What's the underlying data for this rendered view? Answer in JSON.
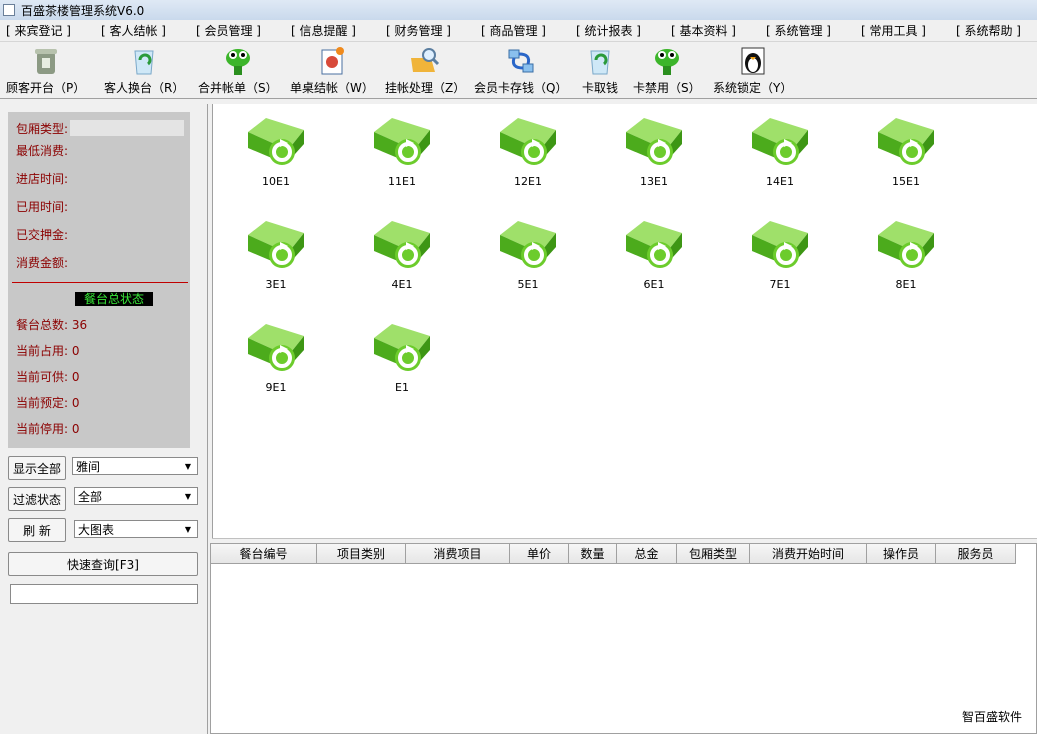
{
  "window": {
    "title": "百盛茶楼管理系统V6.0"
  },
  "menu": [
    "[ 来宾登记 ]",
    "[ 客人结帐 ]",
    "[ 会员管理 ]",
    "[ 信息提醒 ]",
    "[ 财务管理 ]",
    "[ 商品管理 ]",
    "[ 统计报表 ]",
    "[ 基本资料 ]",
    "[ 系统管理 ]",
    "[ 常用工具 ]",
    "[ 系统帮助 ]"
  ],
  "toolbar": [
    {
      "label": "顾客开台（P）",
      "icon": "trash-can-icon"
    },
    {
      "label": "客人换台（R）",
      "icon": "recycle-bin-icon"
    },
    {
      "label": "合并帐单（S）",
      "icon": "green-mascot-icon"
    },
    {
      "label": "单桌结帐（W）",
      "icon": "document-icon"
    },
    {
      "label": "挂帐处理（Z）",
      "icon": "search-folder-icon"
    },
    {
      "label": "会员卡存钱（Q）",
      "icon": "network-icon"
    },
    {
      "label": "卡取钱",
      "icon": "recycle-bin-icon"
    },
    {
      "label": "卡禁用（S）",
      "icon": "green-mascot-icon"
    },
    {
      "label": "系统锁定（Y）",
      "icon": "penguin-icon"
    }
  ],
  "info": {
    "room_type_label": "包厢类型:",
    "min_spend_label": "最低消费:",
    "checkin_label": "进店时间:",
    "used_time_label": "已用时间:",
    "deposit_label": "已交押金:",
    "amount_label": "消费金额:",
    "status_title": "餐台总状态",
    "total_label": "餐台总数:",
    "total_value": "36",
    "occupied_label": "当前占用:",
    "occupied_value": "0",
    "available_label": "当前可供:",
    "available_value": "0",
    "reserved_label": "当前预定:",
    "reserved_value": "0",
    "disabled_label": "当前停用:",
    "disabled_value": "0"
  },
  "controls": {
    "show_all_label": "显示全部",
    "show_all_select": "雅间",
    "filter_label": "过滤状态",
    "filter_select": "全部",
    "refresh_label": "刷  新",
    "view_select": "大图表",
    "quick_search_label": "快速查询[F3]",
    "search_value": ""
  },
  "tables": [
    "10E1",
    "11E1",
    "12E1",
    "13E1",
    "14E1",
    "15E1",
    "3E1",
    "4E1",
    "5E1",
    "6E1",
    "7E1",
    "8E1",
    "9E1",
    "E1"
  ],
  "grid_columns": [
    "餐台编号",
    "项目类别",
    "消费项目",
    "单价",
    "数量",
    "总金",
    "包厢类型",
    "消费开始时间",
    "操作员",
    "服务员"
  ],
  "footer": {
    "brand": "智百盛软件"
  },
  "colors": {
    "accent_green": "#5cc12a",
    "info_text": "#8b0000",
    "status_text": "#38e838"
  }
}
